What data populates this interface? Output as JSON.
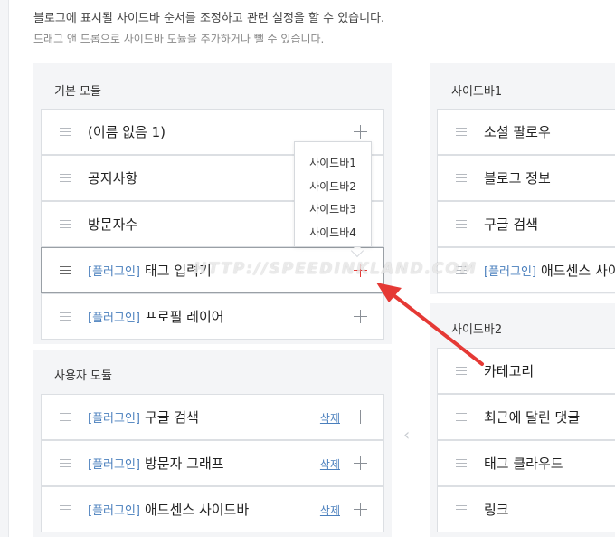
{
  "description": {
    "line1": "블로그에 표시될 사이드바 순서를 조정하고 관련 설정을 할 수 있습니다.",
    "line2": "드래그 앤 드롭으로 사이드바 모듈을 추가하거나 뺄 수 있습니다."
  },
  "basic_modules": {
    "title": "기본 모듈",
    "items": [
      {
        "tag": "",
        "name": "(이름 없음 1)"
      },
      {
        "tag": "",
        "name": "공지사항"
      },
      {
        "tag": "",
        "name": "방문자수"
      },
      {
        "tag": "[플러그인]",
        "name": "태그 입력기"
      },
      {
        "tag": "[플러그인]",
        "name": "프로필 레이어"
      }
    ]
  },
  "user_modules": {
    "title": "사용자 모듈",
    "delete_label": "삭제",
    "items": [
      {
        "tag": "[플러그인]",
        "name": "구글 검색"
      },
      {
        "tag": "[플러그인]",
        "name": "방문자 그래프"
      },
      {
        "tag": "[플러그인]",
        "name": "애드센스 사이드바"
      }
    ]
  },
  "sidebar_menu": {
    "options": [
      "사이드바1",
      "사이드바2",
      "사이드바3",
      "사이드바4"
    ]
  },
  "sidebar1": {
    "title": "사이드바1",
    "items": [
      {
        "tag": "",
        "name": "소셜 팔로우"
      },
      {
        "tag": "",
        "name": "블로그 정보"
      },
      {
        "tag": "",
        "name": "구글 검색"
      },
      {
        "tag": "[플러그인]",
        "name": "애드센스 사이"
      }
    ]
  },
  "sidebar2": {
    "title": "사이드바2",
    "items": [
      {
        "tag": "",
        "name": "카테고리"
      },
      {
        "tag": "",
        "name": "최근에 달린 댓글"
      },
      {
        "tag": "",
        "name": "태그 클라우드"
      },
      {
        "tag": "",
        "name": "링크"
      }
    ]
  },
  "watermark": "HTTP://SPEEDINKLAND.COM",
  "colors": {
    "accent": "#e53935",
    "link": "#4a7fbd",
    "panel_bg": "#f4f5f7"
  }
}
